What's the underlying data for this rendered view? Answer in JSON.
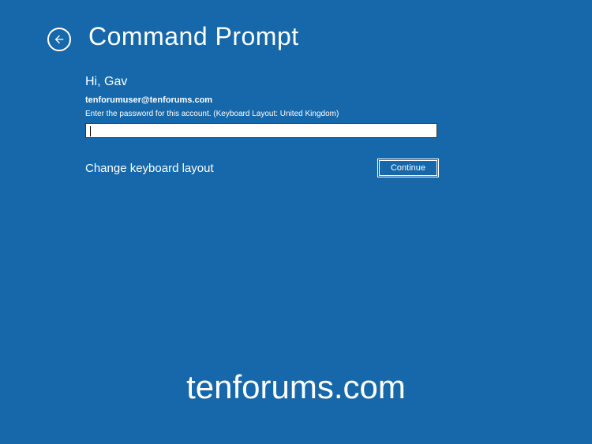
{
  "header": {
    "title": "Command Prompt"
  },
  "content": {
    "greeting": "Hi, Gav",
    "account": "tenforumuser@tenforums.com",
    "instruction": "Enter the password for this account. (Keyboard Layout: United Kingdom)",
    "password_value": "",
    "change_layout_label": "Change keyboard layout",
    "continue_label": "Continue"
  },
  "watermark": "tenforums.com"
}
